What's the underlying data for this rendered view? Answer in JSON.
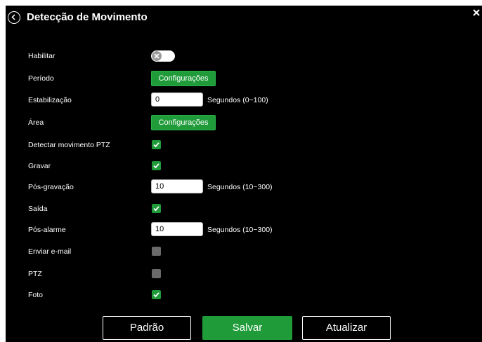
{
  "dialog": {
    "title": "Detecção de Movimento",
    "back_icon": "chevron-left-circle-icon",
    "close_icon": "close-icon"
  },
  "fields": {
    "enable": {
      "label": "Habilitar",
      "state": "off"
    },
    "period": {
      "label": "Período",
      "button": "Configurações"
    },
    "stabilization": {
      "label": "Estabilização",
      "value": "0",
      "hint": "Segundos (0~100)"
    },
    "area": {
      "label": "Área",
      "button": "Configurações"
    },
    "ptz_detect": {
      "label": "Detectar movimento PTZ",
      "checked": true
    },
    "record": {
      "label": "Gravar",
      "checked": true
    },
    "post_record": {
      "label": "Pós-gravação",
      "value": "10",
      "hint": "Segundos (10~300)"
    },
    "output": {
      "label": "Saída",
      "checked": true
    },
    "post_alarm": {
      "label": "Pós-alarme",
      "value": "10",
      "hint": "Segundos (10~300)"
    },
    "send_email": {
      "label": "Enviar e-mail",
      "checked": false
    },
    "ptz": {
      "label": "PTZ",
      "checked": false
    },
    "photo": {
      "label": "Foto",
      "checked": true
    }
  },
  "footer": {
    "default_label": "Padrão",
    "save_label": "Salvar",
    "refresh_label": "Atualizar"
  },
  "colors": {
    "background": "#000000",
    "accent": "#1f9b3a",
    "checkbox_off": "#6a6a6a"
  }
}
